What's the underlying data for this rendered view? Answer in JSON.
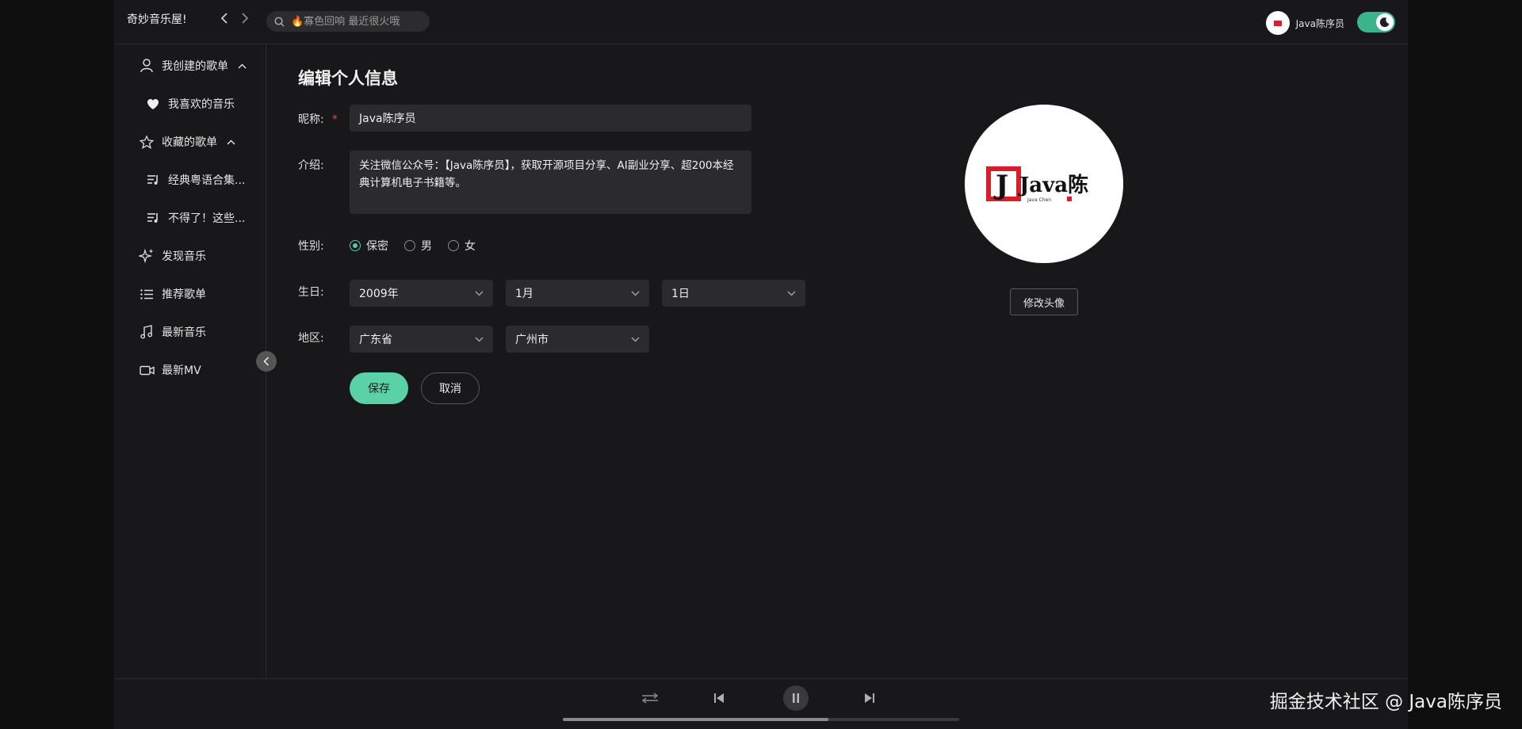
{
  "app": {
    "brand": "奇妙音乐屋!",
    "search_placeholder": "🔥寡色回响 最近很火哦",
    "user_name": "Java陈序员",
    "theme_toggle": "dark"
  },
  "sidebar": {
    "items": [
      {
        "label": "我创建的歌单",
        "icon": "user-icon",
        "expandable": true
      },
      {
        "label": "我喜欢的音乐",
        "icon": "heart-icon",
        "indent": true
      },
      {
        "label": "收藏的歌单",
        "icon": "star-icon",
        "expandable": true
      },
      {
        "label": "经典粤语合集...",
        "icon": "playlist-icon",
        "indent": true
      },
      {
        "label": "不得了！这些...",
        "icon": "playlist-icon",
        "indent": true
      },
      {
        "label": "发现音乐",
        "icon": "sparkle-icon"
      },
      {
        "label": "推荐歌单",
        "icon": "list-icon"
      },
      {
        "label": "最新音乐",
        "icon": "music-note-icon"
      },
      {
        "label": "最新MV",
        "icon": "video-icon"
      }
    ]
  },
  "form": {
    "title": "编辑个人信息",
    "nickname_label": "昵称:",
    "required_mark": "*",
    "nickname_value": "Java陈序员",
    "intro_label": "介绍:",
    "intro_value": "关注微信公众号：【Java陈序员】，获取开源项目分享、AI副业分享、超200本经典计算机电子书籍等。",
    "gender_label": "性别:",
    "gender_options": [
      "保密",
      "男",
      "女"
    ],
    "gender_selected": "保密",
    "birthday_label": "生日:",
    "birthday_year": "2009年",
    "birthday_month": "1月",
    "birthday_day": "1日",
    "region_label": "地区:",
    "province": "广东省",
    "city": "广州市",
    "save_label": "保存",
    "cancel_label": "取消"
  },
  "avatar": {
    "logo_text": "Java陈",
    "logo_subtext": "Java Chen",
    "change_label": "修改头像"
  },
  "player": {
    "progress": 0.67
  },
  "watermark": "掘金技术社区 @ Java陈序员"
}
